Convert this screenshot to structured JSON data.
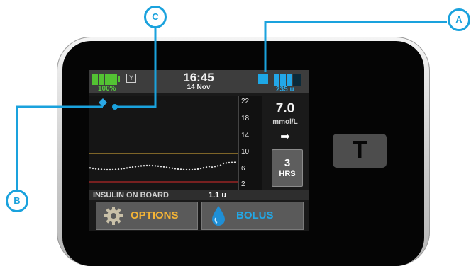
{
  "status_bar": {
    "time": "16:45",
    "date": "14 Nov",
    "battery_percent": "100%",
    "battery_level": 1.0,
    "signal_glyph": "Y",
    "insulin_units": "235 u"
  },
  "cgm": {
    "bg_value": "7.0",
    "bg_unit": "mmol/L",
    "trend": "steady",
    "trend_glyph": "➡",
    "scale_ticks": [
      "22",
      "18",
      "14",
      "10",
      "6",
      "2"
    ],
    "high_threshold": 10,
    "low_threshold": 4,
    "time_range_value": "3",
    "time_range_unit": "HRS"
  },
  "insulin_on_board": {
    "label": "INSULIN ON BOARD",
    "value": "1.1 u"
  },
  "buttons": {
    "options": "OPTIONS",
    "bolus": "BOLUS"
  },
  "callouts": {
    "a": "A",
    "b": "B",
    "c": "C"
  },
  "logo": {
    "letter": "T"
  },
  "colors": {
    "accent_blue": "#1aa2dd",
    "battery_green": "#53c233",
    "options_orange": "#f4b436",
    "high_line": "#e8b53a",
    "low_line": "#d92b2b"
  }
}
